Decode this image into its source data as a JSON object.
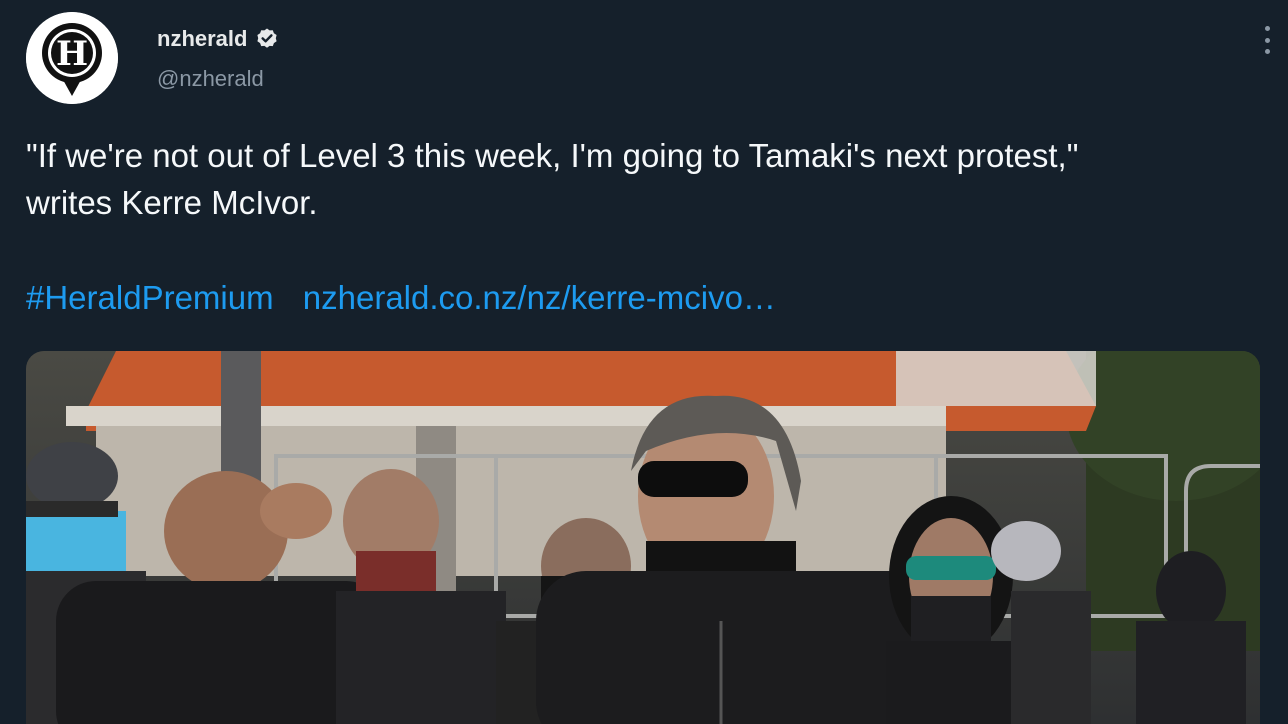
{
  "tweet": {
    "author": {
      "display_name": "nzherald",
      "handle": "@nzherald",
      "verified": true,
      "avatar_icon": "nz-herald-logo-icon"
    },
    "body_lines": [
      "\"If we're not out of Level 3 this week, I'm going to Tamaki's next protest,\"",
      "writes Kerre McIvor."
    ],
    "hashtag": "#HeraldPremium",
    "link": "nzherald.co.nz/nz/kerre-mcivo…",
    "more_icon": "more-options-icon",
    "media_icon": "photo-icon"
  },
  "colors": {
    "background": "#15202b",
    "text": "#f5f8fa",
    "secondary": "#8b98a5",
    "link": "#1d9bf0"
  }
}
